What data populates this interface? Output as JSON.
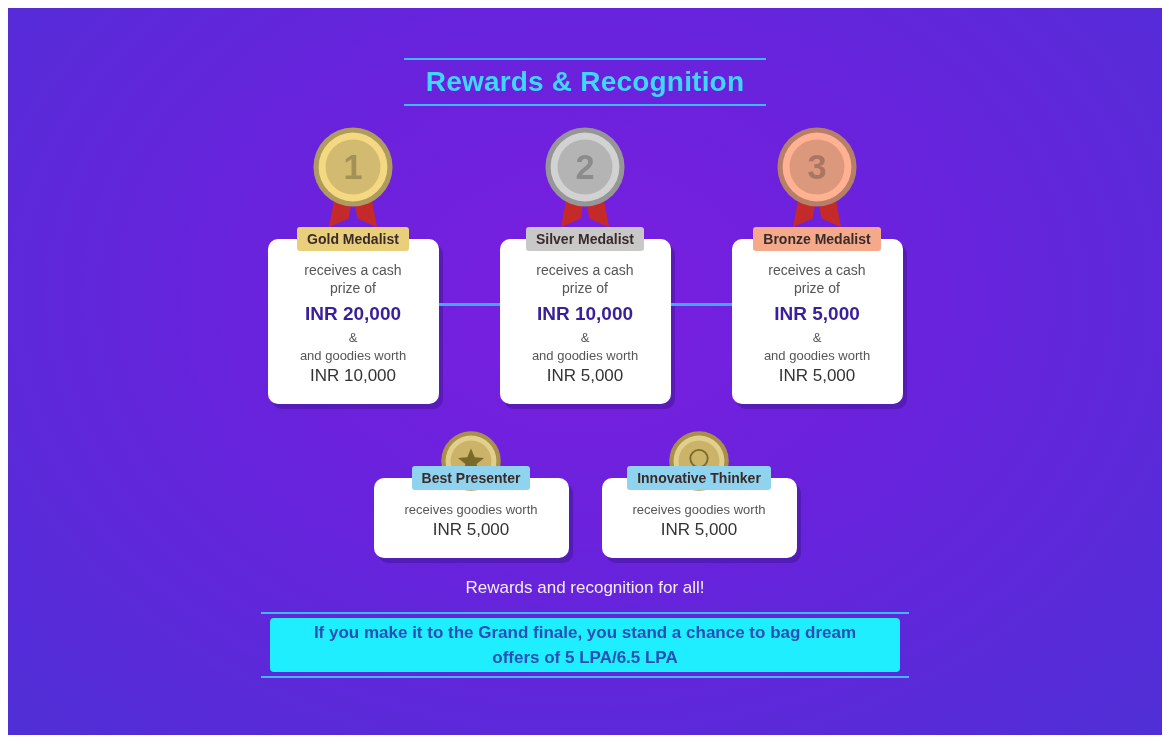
{
  "title": "Rewards & Recognition",
  "prizes": [
    {
      "rank": "1",
      "label": "Gold Medalist",
      "color": "#e9cf7c",
      "intro": "receives a cash prize of",
      "amount": "INR 20,000",
      "joiner": "&",
      "goodies": "and goodies worth",
      "goodies_amount": "INR 10,000"
    },
    {
      "rank": "2",
      "label": "Silver Medalist",
      "color": "#c8c8c8",
      "intro": "receives a cash prize of",
      "amount": "INR 10,000",
      "joiner": "&",
      "goodies": "and goodies worth",
      "goodies_amount": "INR 5,000"
    },
    {
      "rank": "3",
      "label": "Bronze Medalist",
      "color": "#f3a98a",
      "intro": "receives a cash prize of",
      "amount": "INR 5,000",
      "joiner": "&",
      "goodies": "and goodies worth",
      "goodies_amount": "INR 5,000"
    }
  ],
  "awards": [
    {
      "kind": "star",
      "label": "Best Presenter",
      "text": "receives goodies worth",
      "amount": "INR 5,000"
    },
    {
      "kind": "bulb",
      "label": "Innovative Thinker",
      "text": "receives goodies worth",
      "amount": "INR 5,000"
    }
  ],
  "tagline": "Rewards and recognition for all!",
  "banner": "If you make it to the Grand finale, you stand a chance to bag dream offers of 5 LPA/6.5 LPA"
}
